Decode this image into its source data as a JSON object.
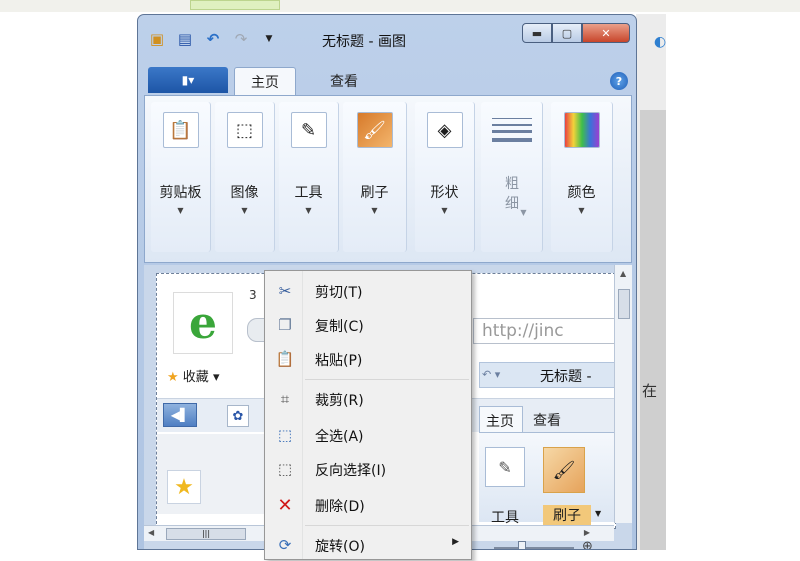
{
  "window": {
    "title": "无标题 - 画图",
    "controls": {
      "minimize": "▬",
      "maximize": "▢",
      "close": "✕"
    }
  },
  "quick_access": {
    "icons": [
      "app-icon",
      "save-icon",
      "undo-icon",
      "redo-icon",
      "customize-dropdown-icon"
    ]
  },
  "ribbon": {
    "file_button_glyph": "▮▾",
    "tabs": [
      {
        "label": "主页",
        "active": true
      },
      {
        "label": "查看",
        "active": false
      }
    ],
    "help_glyph": "?",
    "groups": [
      {
        "label": "剪贴板",
        "icon": "clipboard-icon"
      },
      {
        "label": "图像",
        "icon": "image-select-icon"
      },
      {
        "label": "工具",
        "icon": "tools-icon"
      },
      {
        "label": "刷子",
        "icon": "brush-icon"
      },
      {
        "label": "形状",
        "icon": "shapes-icon"
      },
      {
        "label": "粗细",
        "icon": "size-icon",
        "disabled": true
      },
      {
        "label": "颜色",
        "icon": "colors-icon"
      }
    ]
  },
  "pasted_image": {
    "fragment_number": "3",
    "address_text": "http://jinc",
    "favorites_label": "收藏",
    "inner_window_title": "无标题 -",
    "inner_tabs": [
      "主页",
      "查看"
    ],
    "inner_tool_label": "工具",
    "inner_brush_label": "刷子"
  },
  "context_menu": {
    "items": [
      {
        "label": "剪切(T)",
        "icon": "scissors-icon"
      },
      {
        "label": "复制(C)",
        "icon": "copy-icon"
      },
      {
        "label": "粘贴(P)",
        "icon": "paste-icon"
      },
      {
        "label": "裁剪(R)",
        "icon": "crop-icon"
      },
      {
        "label": "全选(A)",
        "icon": "select-all-icon"
      },
      {
        "label": "反向选择(I)",
        "icon": "invert-selection-icon"
      },
      {
        "label": "删除(D)",
        "icon": "delete-icon"
      },
      {
        "label": "旋转(O)",
        "icon": "rotate-icon",
        "has_submenu": true
      }
    ]
  },
  "colors": {
    "ribbon_bg": "#dde7f4",
    "file_button": "#1d55a6",
    "close_button": "#c8452b",
    "menu_bg": "#f0f0f0",
    "delete_icon": "#d01818"
  }
}
